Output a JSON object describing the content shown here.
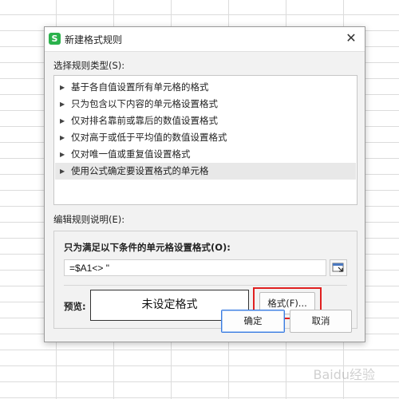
{
  "dialog": {
    "title": "新建格式规则",
    "close_glyph": "✕",
    "app_icon_glyph": "S"
  },
  "rule_type": {
    "label": "选择规则类型(S):",
    "items": [
      {
        "label": "基于各自值设置所有单元格的格式",
        "selected": false
      },
      {
        "label": "只为包含以下内容的单元格设置格式",
        "selected": false
      },
      {
        "label": "仅对排名靠前或靠后的数值设置格式",
        "selected": false
      },
      {
        "label": "仅对高于或低于平均值的数值设置格式",
        "selected": false
      },
      {
        "label": "仅对唯一值或重复值设置格式",
        "selected": false
      },
      {
        "label": "使用公式确定要设置格式的单元格",
        "selected": true
      }
    ]
  },
  "edit": {
    "label": "编辑规则说明(E):",
    "condition_label": "只为满足以下条件的单元格设置格式(O):",
    "formula_value": "=$A1<> \"",
    "preview_label": "预览:",
    "preview_text": "未设定格式",
    "format_button": "格式(F)..."
  },
  "buttons": {
    "ok": "确定",
    "cancel": "取消"
  },
  "watermark": "Baidu经验",
  "colors": {
    "highlight": "#e02020",
    "app_icon": "#2bb24c"
  }
}
